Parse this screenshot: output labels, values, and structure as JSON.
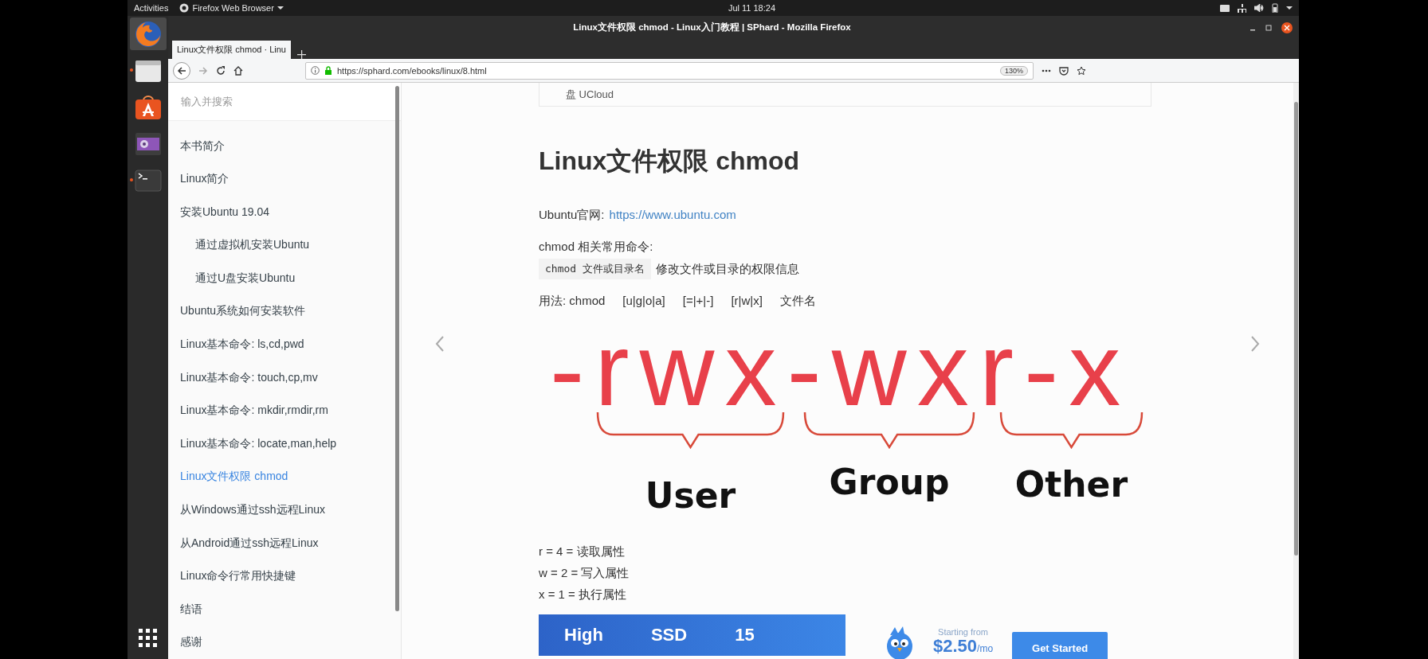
{
  "top_bar": {
    "activities": "Activities",
    "app_menu": "Firefox Web Browser",
    "clock": "Jul 11  18:24"
  },
  "dock": [
    {
      "kind": "firefox",
      "selected": true,
      "running": false
    },
    {
      "kind": "files",
      "selected": false,
      "running": true
    },
    {
      "kind": "software",
      "selected": false,
      "running": false
    },
    {
      "kind": "video",
      "selected": false,
      "running": false
    },
    {
      "kind": "terminal",
      "selected": false,
      "running": true
    },
    {
      "kind": "apps",
      "selected": false,
      "running": false
    }
  ],
  "window": {
    "title": "Linux文件权限 chmod - Linux入门教程 | SPhard - Mozilla Firefox"
  },
  "tabs": [
    {
      "label": "Linux文件权限 chmod · Linu",
      "selected": true
    }
  ],
  "address_bar": {
    "url": "https://sphard.com/ebooks/linux/8.html",
    "zoom": "130%"
  },
  "sidebar": {
    "search": {
      "placeholder": "输入并搜索"
    },
    "items": [
      {
        "label": "本书简介",
        "selected": false
      },
      {
        "label": "Linux简介",
        "selected": false
      },
      {
        "label": "安装Ubuntu 19.04",
        "selected": false,
        "children": [
          {
            "label": "通过虚拟机安装Ubuntu",
            "selected": false
          },
          {
            "label": "通过U盘安装Ubuntu",
            "selected": false
          }
        ]
      },
      {
        "label": "Ubuntu系统如何安装软件",
        "selected": false
      },
      {
        "label": "Linux基本命令: ls,cd,pwd",
        "selected": false
      },
      {
        "label": "Linux基本命令: touch,cp,mv",
        "selected": false
      },
      {
        "label": "Linux基本命令: mkdir,rmdir,rm",
        "selected": false
      },
      {
        "label": "Linux基本命令: locate,man,help",
        "selected": false
      },
      {
        "label": "Linux文件权限 chmod",
        "selected": true
      },
      {
        "label": "从Windows通过ssh远程Linux",
        "selected": false
      },
      {
        "label": "从Android通过ssh远程Linux",
        "selected": false
      },
      {
        "label": "Linux命令行常用快捷键",
        "selected": false
      },
      {
        "label": "结语",
        "selected": false
      },
      {
        "label": "感谢",
        "selected": false
      }
    ]
  },
  "content": {
    "prev_card": "盘 UCloud",
    "heading": "Linux文件权限 chmod",
    "site_line": {
      "label": "Ubuntu官网:",
      "link": "https://www.ubuntu.com"
    },
    "commands_title": "chmod 相关常用命令:",
    "command": {
      "code": "chmod 文件或目录名",
      "description": "修改文件或目录的权限信息"
    },
    "usage": [
      "用法: chmod",
      "[u|g|o|a]",
      "[=|+|-]",
      "[r|w|x]",
      "文件名"
    ],
    "diagram": {
      "permissions": "-rwx-wxr-x",
      "groups": [
        "User",
        "Group",
        "Other"
      ]
    },
    "values": [
      "r = 4 = 读取属性",
      "w = 2 = 写入属性",
      "x = 1 = 执行属性"
    ],
    "ad": {
      "banner_words": [
        "High",
        "SSD",
        "15"
      ],
      "price_caption": "Starting from",
      "price": "$2.50",
      "price_unit": "/mo",
      "button": "Get Started"
    }
  }
}
